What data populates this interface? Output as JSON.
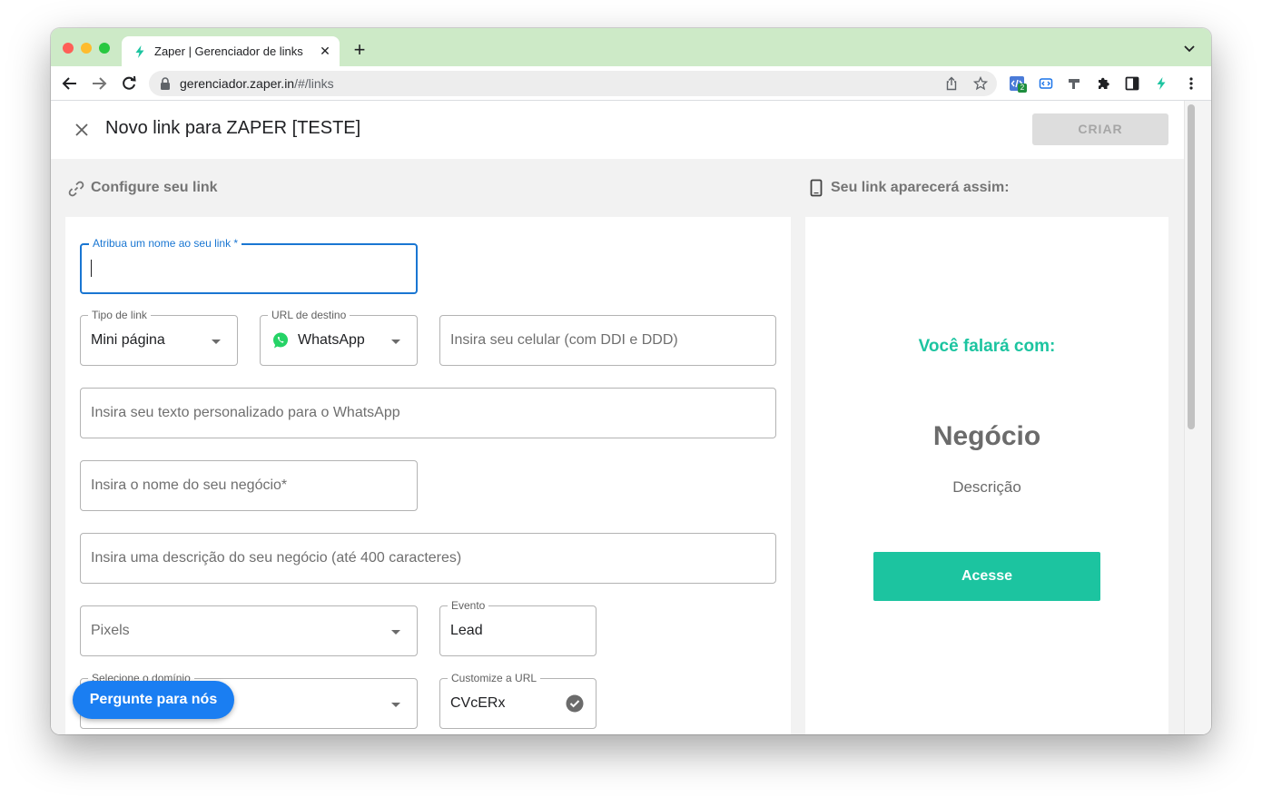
{
  "browser": {
    "tab_title": "Zaper | Gerenciador de links",
    "url_host": "gerenciador.zaper.in",
    "url_path": "/#/links",
    "extension_badge": "2"
  },
  "header": {
    "title": "Novo link para ZAPER [TESTE]",
    "create_label": "CRIAR"
  },
  "config": {
    "section_title": "Configure seu link",
    "fields": {
      "name": {
        "label": "Atribua um nome ao seu link *"
      },
      "link_type": {
        "label": "Tipo de link",
        "value": "Mini página"
      },
      "destination": {
        "label": "URL de destino",
        "value": "WhatsApp"
      },
      "phone": {
        "placeholder": "Insira seu celular (com DDI e DDD)"
      },
      "message": {
        "placeholder": "Insira seu texto personalizado para o WhatsApp"
      },
      "business_name": {
        "placeholder": "Insira o nome do seu negócio*"
      },
      "business_desc": {
        "placeholder": "Insira uma descrição do seu negócio (até 400 caracteres)"
      },
      "pixels": {
        "placeholder": "Pixels"
      },
      "event": {
        "label": "Evento",
        "value": "Lead"
      },
      "domain": {
        "label": "Selecione o domínio"
      },
      "custom_url": {
        "label": "Customize a URL",
        "value": "CVcERx"
      }
    },
    "help_button": "Pergunte para nós"
  },
  "preview": {
    "section_title": "Seu link aparecerá assim:",
    "heading": "Você falará com:",
    "business_name": "Negócio",
    "description": "Descrição",
    "button_label": "Acesse"
  },
  "colors": {
    "accent": "#1cc4a0",
    "primary_blue": "#1976d2",
    "help_blue": "#1a7ef2",
    "tabbar_green": "#cdeac7"
  }
}
